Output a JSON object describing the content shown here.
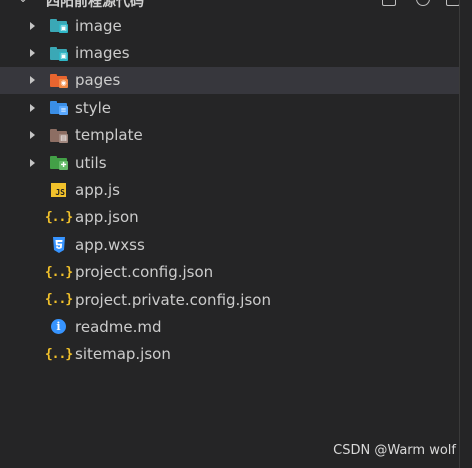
{
  "header": {
    "title": "四阳前程源代码"
  },
  "tree": [
    {
      "label": "image",
      "kind": "folder",
      "color": "#3aa8b6",
      "badge_color": "#2fb7c7",
      "badge": "▣"
    },
    {
      "label": "images",
      "kind": "folder",
      "color": "#3aa8b6",
      "badge_color": "#2fb7c7",
      "badge": "▣"
    },
    {
      "label": "pages",
      "kind": "folder",
      "color": "#e8652f",
      "badge_color": "#f28a46",
      "badge": "◉"
    },
    {
      "label": "style",
      "kind": "folder",
      "color": "#3a8ee6",
      "badge_color": "#5aa9ff",
      "badge": "≡"
    },
    {
      "label": "template",
      "kind": "folder",
      "color": "#8d6e63",
      "badge_color": "#a1887f",
      "badge": "▤"
    },
    {
      "label": "utils",
      "kind": "folder",
      "color": "#43a047",
      "badge_color": "#66bb6a",
      "badge": "✚"
    },
    {
      "label": "app.js",
      "kind": "file",
      "icon": "js-file-icon"
    },
    {
      "label": "app.json",
      "kind": "file",
      "icon": "json-file-icon"
    },
    {
      "label": "app.wxss",
      "kind": "file",
      "icon": "css3-file-icon"
    },
    {
      "label": "project.config.json",
      "kind": "file",
      "icon": "json-file-icon"
    },
    {
      "label": "project.private.config.json",
      "kind": "file",
      "icon": "json-file-icon"
    },
    {
      "label": "readme.md",
      "kind": "file",
      "icon": "info-file-icon"
    },
    {
      "label": "sitemap.json",
      "kind": "file",
      "icon": "json-file-icon"
    }
  ],
  "selected_index": 2,
  "watermark": "CSDN @Warm wolf"
}
